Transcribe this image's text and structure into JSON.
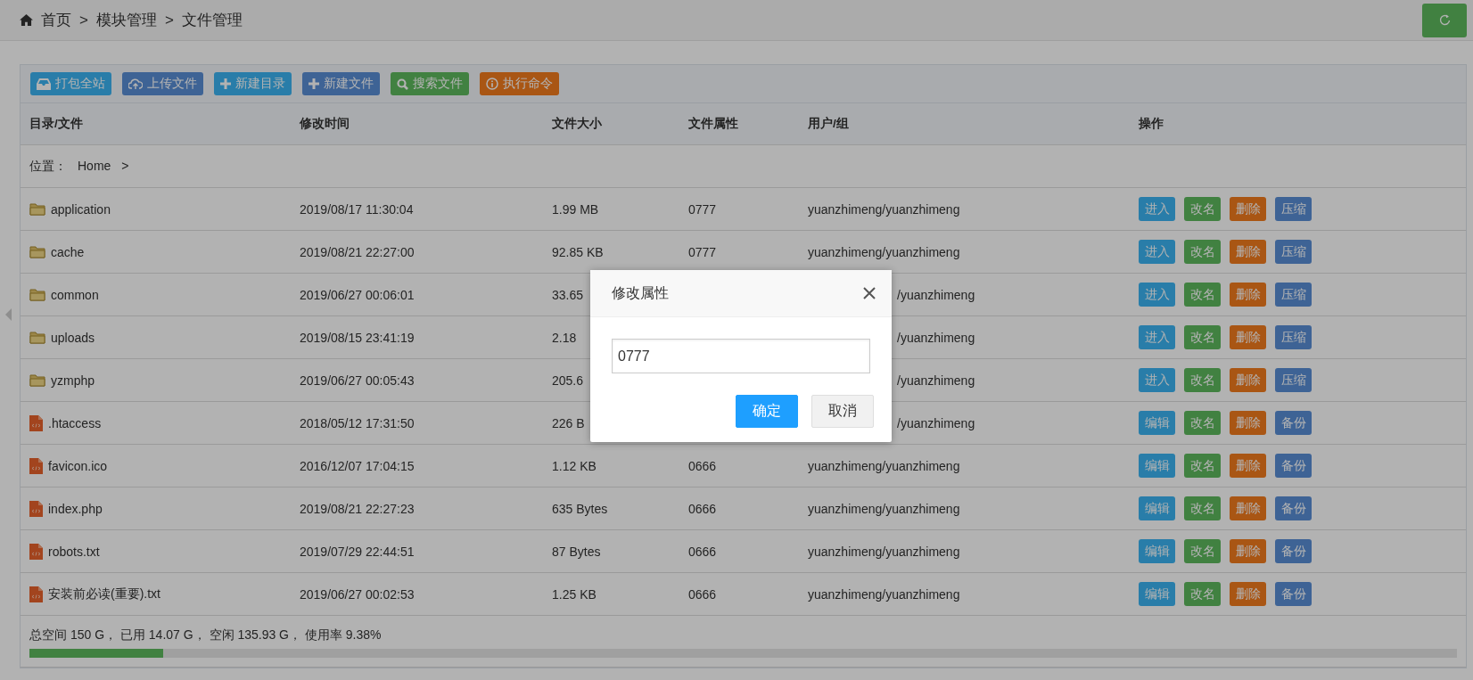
{
  "breadcrumb": [
    "首页",
    ">",
    "模块管理",
    ">",
    "文件管理"
  ],
  "toolbar": [
    {
      "label": "打包全站",
      "kind": "pack"
    },
    {
      "label": "上传文件",
      "kind": "upload"
    },
    {
      "label": "新建目录",
      "kind": "mkdir"
    },
    {
      "label": "新建文件",
      "kind": "newfile"
    },
    {
      "label": "搜索文件",
      "kind": "search"
    },
    {
      "label": "执行命令",
      "kind": "exec"
    }
  ],
  "columns": [
    "目录/文件",
    "修改时间",
    "文件大小",
    "文件属性",
    "用户/组",
    "操作"
  ],
  "location": {
    "label": "位置：",
    "path": "Home",
    "separator": ">"
  },
  "rows": [
    {
      "kind": "plain",
      "is_folder": true,
      "name": "application",
      "time": "2019/08/17 11:30:04",
      "size": "1.99 MB",
      "attr": "0777",
      "user": "yuanzhimeng/yuanzhimeng",
      "actions": [
        {
          "label": "进入",
          "kind": "enter"
        },
        {
          "label": "改名",
          "kind": "rename"
        },
        {
          "label": "删除",
          "kind": "delete"
        },
        {
          "label": "压缩",
          "kind": "compress"
        }
      ]
    },
    {
      "kind": "plain",
      "is_folder": true,
      "name": "cache",
      "time": "2019/08/21 22:27:00",
      "size": "92.85 KB",
      "attr": "0777",
      "user": "yuanzhimeng/yuanzhimeng",
      "actions": [
        {
          "label": "进入",
          "kind": "enter"
        },
        {
          "label": "改名",
          "kind": "rename"
        },
        {
          "label": "删除",
          "kind": "delete"
        },
        {
          "label": "压缩",
          "kind": "compress"
        }
      ]
    },
    {
      "kind": "covered",
      "is_folder": true,
      "name": "common",
      "time": "2019/06/27 00:06:01",
      "size": "33.65",
      "user": "/yuanzhimeng",
      "actions": [
        {
          "label": "进入",
          "kind": "enter"
        },
        {
          "label": "改名",
          "kind": "rename"
        },
        {
          "label": "删除",
          "kind": "delete"
        },
        {
          "label": "压缩",
          "kind": "compress"
        }
      ]
    },
    {
      "kind": "covered",
      "is_folder": true,
      "name": "uploads",
      "time": "2019/08/15 23:41:19",
      "size": "2.18",
      "user": "/yuanzhimeng",
      "actions": [
        {
          "label": "进入",
          "kind": "enter"
        },
        {
          "label": "改名",
          "kind": "rename"
        },
        {
          "label": "删除",
          "kind": "delete"
        },
        {
          "label": "压缩",
          "kind": "compress"
        }
      ]
    },
    {
      "kind": "covered",
      "is_folder": true,
      "name": "yzmphp",
      "time": "2019/06/27 00:05:43",
      "size": "205.6",
      "user": "/yuanzhimeng",
      "actions": [
        {
          "label": "进入",
          "kind": "enter"
        },
        {
          "label": "改名",
          "kind": "rename"
        },
        {
          "label": "删除",
          "kind": "delete"
        },
        {
          "label": "压缩",
          "kind": "compress"
        }
      ]
    },
    {
      "kind": "covered",
      "is_folder": false,
      "name": ".htaccess",
      "time": "2018/05/12 17:31:50",
      "size": "226 B",
      "user": "/yuanzhimeng",
      "actions": [
        {
          "label": "编辑",
          "kind": "edit"
        },
        {
          "label": "改名",
          "kind": "rename"
        },
        {
          "label": "删除",
          "kind": "delete"
        },
        {
          "label": "备份",
          "kind": "backup"
        }
      ]
    },
    {
      "kind": "plain",
      "is_folder": false,
      "name": "favicon.ico",
      "time": "2016/12/07 17:04:15",
      "size": "1.12 KB",
      "attr": "0666",
      "user": "yuanzhimeng/yuanzhimeng",
      "actions": [
        {
          "label": "编辑",
          "kind": "edit"
        },
        {
          "label": "改名",
          "kind": "rename"
        },
        {
          "label": "删除",
          "kind": "delete"
        },
        {
          "label": "备份",
          "kind": "backup"
        }
      ]
    },
    {
      "kind": "plain",
      "is_folder": false,
      "name": "index.php",
      "time": "2019/08/21 22:27:23",
      "size": "635 Bytes",
      "attr": "0666",
      "user": "yuanzhimeng/yuanzhimeng",
      "actions": [
        {
          "label": "编辑",
          "kind": "edit"
        },
        {
          "label": "改名",
          "kind": "rename"
        },
        {
          "label": "删除",
          "kind": "delete"
        },
        {
          "label": "备份",
          "kind": "backup"
        }
      ]
    },
    {
      "kind": "plain",
      "is_folder": false,
      "name": "robots.txt",
      "time": "2019/07/29 22:44:51",
      "size": "87 Bytes",
      "attr": "0666",
      "user": "yuanzhimeng/yuanzhimeng",
      "actions": [
        {
          "label": "编辑",
          "kind": "edit"
        },
        {
          "label": "改名",
          "kind": "rename"
        },
        {
          "label": "删除",
          "kind": "delete"
        },
        {
          "label": "备份",
          "kind": "backup"
        }
      ]
    },
    {
      "kind": "plain",
      "is_folder": false,
      "name": "安装前必读(重要).txt",
      "time": "2019/06/27 00:02:53",
      "size": "1.25 KB",
      "attr": "0666",
      "user": "yuanzhimeng/yuanzhimeng",
      "actions": [
        {
          "label": "编辑",
          "kind": "edit"
        },
        {
          "label": "改名",
          "kind": "rename"
        },
        {
          "label": "删除",
          "kind": "delete"
        },
        {
          "label": "备份",
          "kind": "backup"
        }
      ]
    }
  ],
  "storage": {
    "summary": "总空间 150 G， 已用 14.07 G， 空闲 135.93 G， 使用率 9.38%",
    "level": 0.0938
  },
  "dialog": {
    "title": "修改属性",
    "value": "0777",
    "buttons": [
      {
        "label": "确定",
        "kind": "primary"
      },
      {
        "label": "取消",
        "kind": "secondary"
      }
    ]
  }
}
